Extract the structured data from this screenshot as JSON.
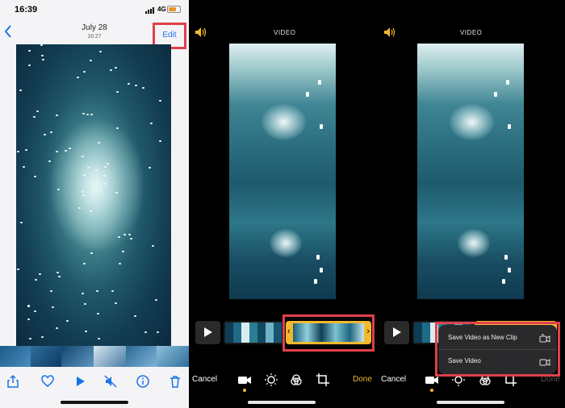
{
  "panel1": {
    "status": {
      "time": "16:39",
      "network": "4G"
    },
    "header": {
      "date": "July 28",
      "time": "16:27",
      "edit_label": "Edit"
    }
  },
  "panel2": {
    "title": "VIDEO",
    "cancel_label": "Cancel",
    "done_label": "Done"
  },
  "panel3": {
    "title": "VIDEO",
    "cancel_label": "Cancel",
    "done_label": "Done",
    "menu": {
      "items": [
        {
          "label": "Save Video as New Clip",
          "icon": "video-plus-icon"
        },
        {
          "label": "Save Video",
          "icon": "video-icon"
        }
      ]
    }
  },
  "colors": {
    "ios_blue": "#1a73e8",
    "highlight_red": "#e0404c",
    "trim_yellow": "#f2b92c",
    "active_yellow": "#f2b92c"
  }
}
